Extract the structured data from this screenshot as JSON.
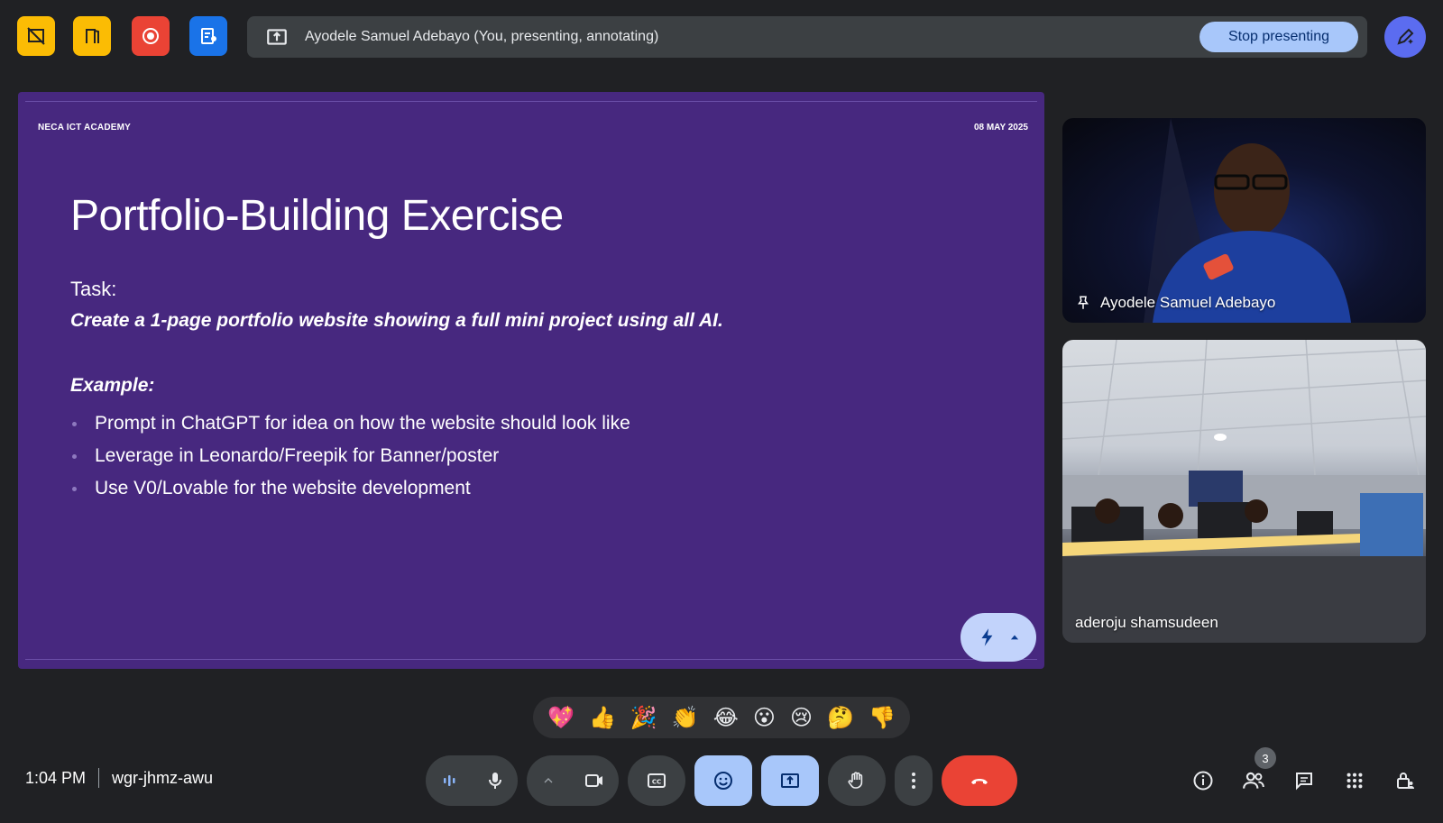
{
  "top_bar": {
    "presenting_label": "Ayodele Samuel Adebayo (You, presenting, annotating)",
    "stop_presenting_label": "Stop presenting"
  },
  "slide": {
    "org": "NECA ICT ACADEMY",
    "date": "08 MAY 2025",
    "title": "Portfolio-Building Exercise",
    "task_label": "Task:",
    "task_text": "Create a 1-page portfolio website showing a full mini project using all AI.",
    "example_label": "Example:",
    "bullets": [
      "Prompt in ChatGPT for idea on how the website should look like",
      "Leverage in Leonardo/Freepik for Banner/poster",
      "Use V0/Lovable for the website development"
    ]
  },
  "participants": [
    {
      "name": "Ayodele Samuel Adebayo"
    },
    {
      "name": "aderoju shamsudeen"
    }
  ],
  "reactions": [
    "💖",
    "👍",
    "🎉",
    "👏",
    "😂",
    "😮",
    "😢",
    "🤔",
    "👎"
  ],
  "meeting": {
    "time": "1:04 PM",
    "code": "wgr-jhmz-awu",
    "participant_count": "3"
  },
  "colors": {
    "slide_bg": "#47287f",
    "accent_blue": "#a8c7fa",
    "end_call_red": "#ea4335",
    "yellow_tool": "#fbbc04",
    "red_tool": "#ea4335",
    "blue_tool": "#1a73e8"
  }
}
